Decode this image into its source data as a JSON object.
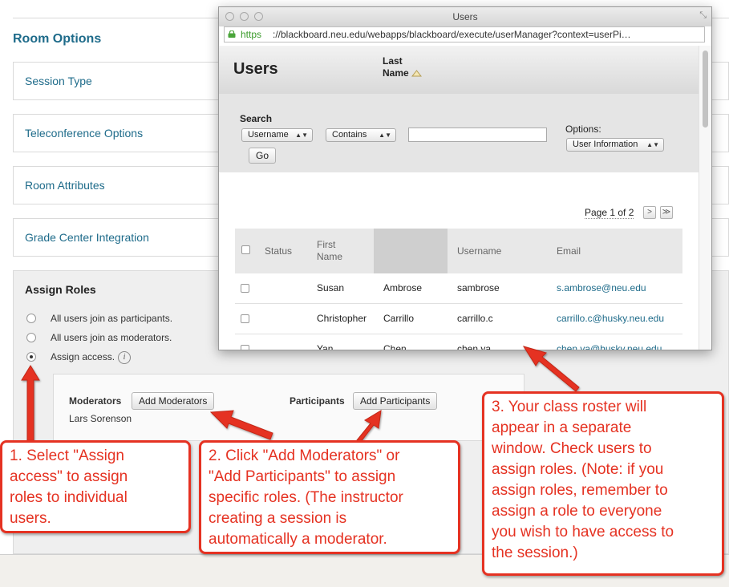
{
  "background": {
    "room_options_title": "Room Options",
    "sections": [
      "Session Type",
      "Teleconference Options",
      "Room Attributes",
      "Grade Center Integration"
    ],
    "assign_roles": {
      "title": "Assign Roles",
      "options": [
        "All users join as participants.",
        "All users join as moderators.",
        "Assign access."
      ],
      "info_glyph": "i",
      "moderators_label": "Moderators",
      "add_moderators": "Add Moderators",
      "moderator_name": "Lars Sorenson",
      "participants_label": "Participants",
      "add_participants": "Add Participants"
    }
  },
  "popup": {
    "window_title": "Users",
    "url_scheme": "https",
    "url_rest": "://blackboard.neu.edu/webapps/blackboard/execute/userManager?context=userPi…",
    "page_heading": "Users",
    "search_label": "Search",
    "field_select": "Username",
    "operator_select": "Contains",
    "search_value": "",
    "options_label": "Options:",
    "options_select": "User Information",
    "go_button": "Go",
    "pager_text": "Page 1 of 2",
    "next_glyph": ">",
    "last_glyph": "≫",
    "columns": {
      "status": "Status",
      "first_name_1": "First",
      "first_name_2": "Name",
      "last_name_1": "Last",
      "last_name_2": "Name",
      "username": "Username",
      "email": "Email"
    },
    "rows": [
      {
        "first": "Susan",
        "last": "Ambrose",
        "username": "sambrose",
        "email": "s.ambrose@neu.edu"
      },
      {
        "first": "Christopher",
        "last": "Carrillo",
        "username": "carrillo.c",
        "email": "carrillo.c@husky.neu.edu"
      },
      {
        "first": "Yan",
        "last": "Chen",
        "username": "chen.ya",
        "email": "chen.ya@husky.neu.edu"
      }
    ]
  },
  "callouts": {
    "one": [
      "1. Select \"Assign",
      "access\" to assign",
      "roles to individual",
      "users."
    ],
    "two": [
      "2. Click \"Add Moderators\" or",
      "\"Add Participants\" to assign",
      "specific roles. (The instructor",
      "creating a session is",
      "automatically a moderator."
    ],
    "three": [
      "3. Your class roster will",
      "appear in a separate",
      "window. Check users to",
      "assign roles. (Note: if you",
      "assign roles, remember to",
      "assign a role to everyone",
      "you wish to have access to",
      "the session.)"
    ]
  },
  "colors": {
    "link": "#1e6b8a",
    "annotation": "#e53222",
    "url_secure": "#3a9a2a"
  }
}
